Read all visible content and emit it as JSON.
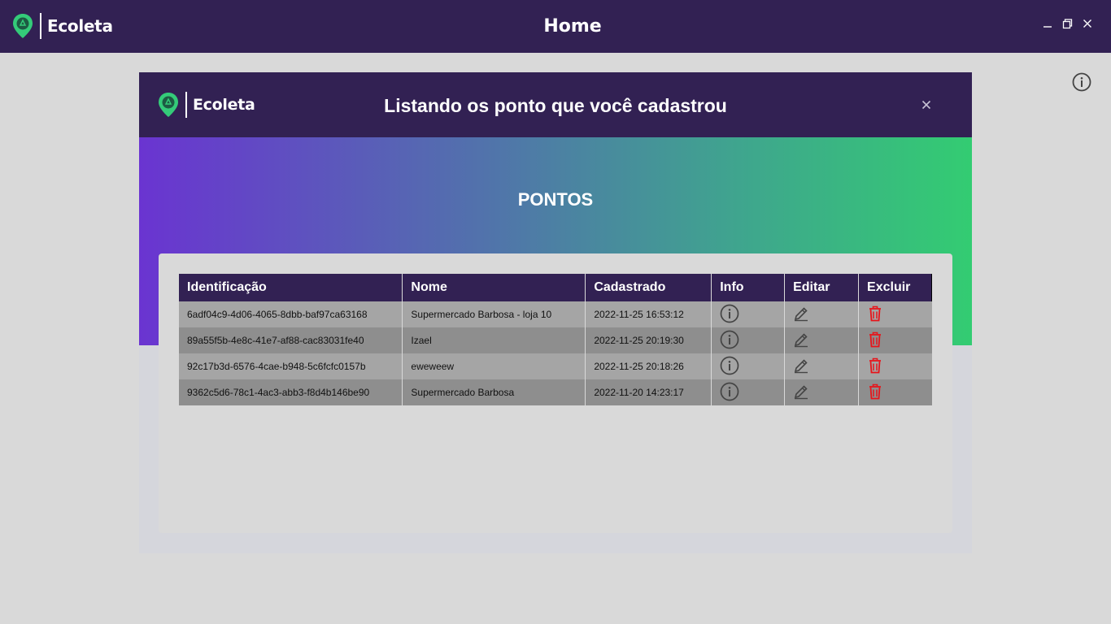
{
  "window": {
    "app_name": "Ecoleta",
    "title": "Home",
    "controls": [
      "minimize-icon",
      "restore-icon",
      "close-icon"
    ]
  },
  "modal": {
    "app_name": "Ecoleta",
    "title": "Listando os ponto que você cadastrou",
    "section_title": "PONTOS"
  },
  "table": {
    "headers": [
      "Identificação",
      "Nome",
      "Cadastrado",
      "Info",
      "Editar",
      "Excluir"
    ],
    "rows": [
      {
        "id": "6adf04c9-4d06-4065-8dbb-baf97ca63168",
        "nome": "Supermercado Barbosa - loja 10",
        "cadastrado": "2022-11-25 16:53:12"
      },
      {
        "id": "89a55f5b-4e8c-41e7-af88-cac83031fe40",
        "nome": "Izael",
        "cadastrado": "2022-11-25 20:19:30"
      },
      {
        "id": "92c17b3d-6576-4cae-b948-5c6fcfc0157b",
        "nome": "eweweew",
        "cadastrado": "2022-11-25 20:18:26"
      },
      {
        "id": "9362c5d6-78c1-4ac3-abb3-f8d4b146be90",
        "nome": "Supermercado Barbosa",
        "cadastrado": "2022-11-20 14:23:17"
      }
    ]
  },
  "colors": {
    "header_bg": "#322153",
    "brand_green": "#34cb79",
    "delete_red": "#e8141a",
    "gradient_start": "#6a34d1",
    "gradient_end": "#33cc72"
  }
}
